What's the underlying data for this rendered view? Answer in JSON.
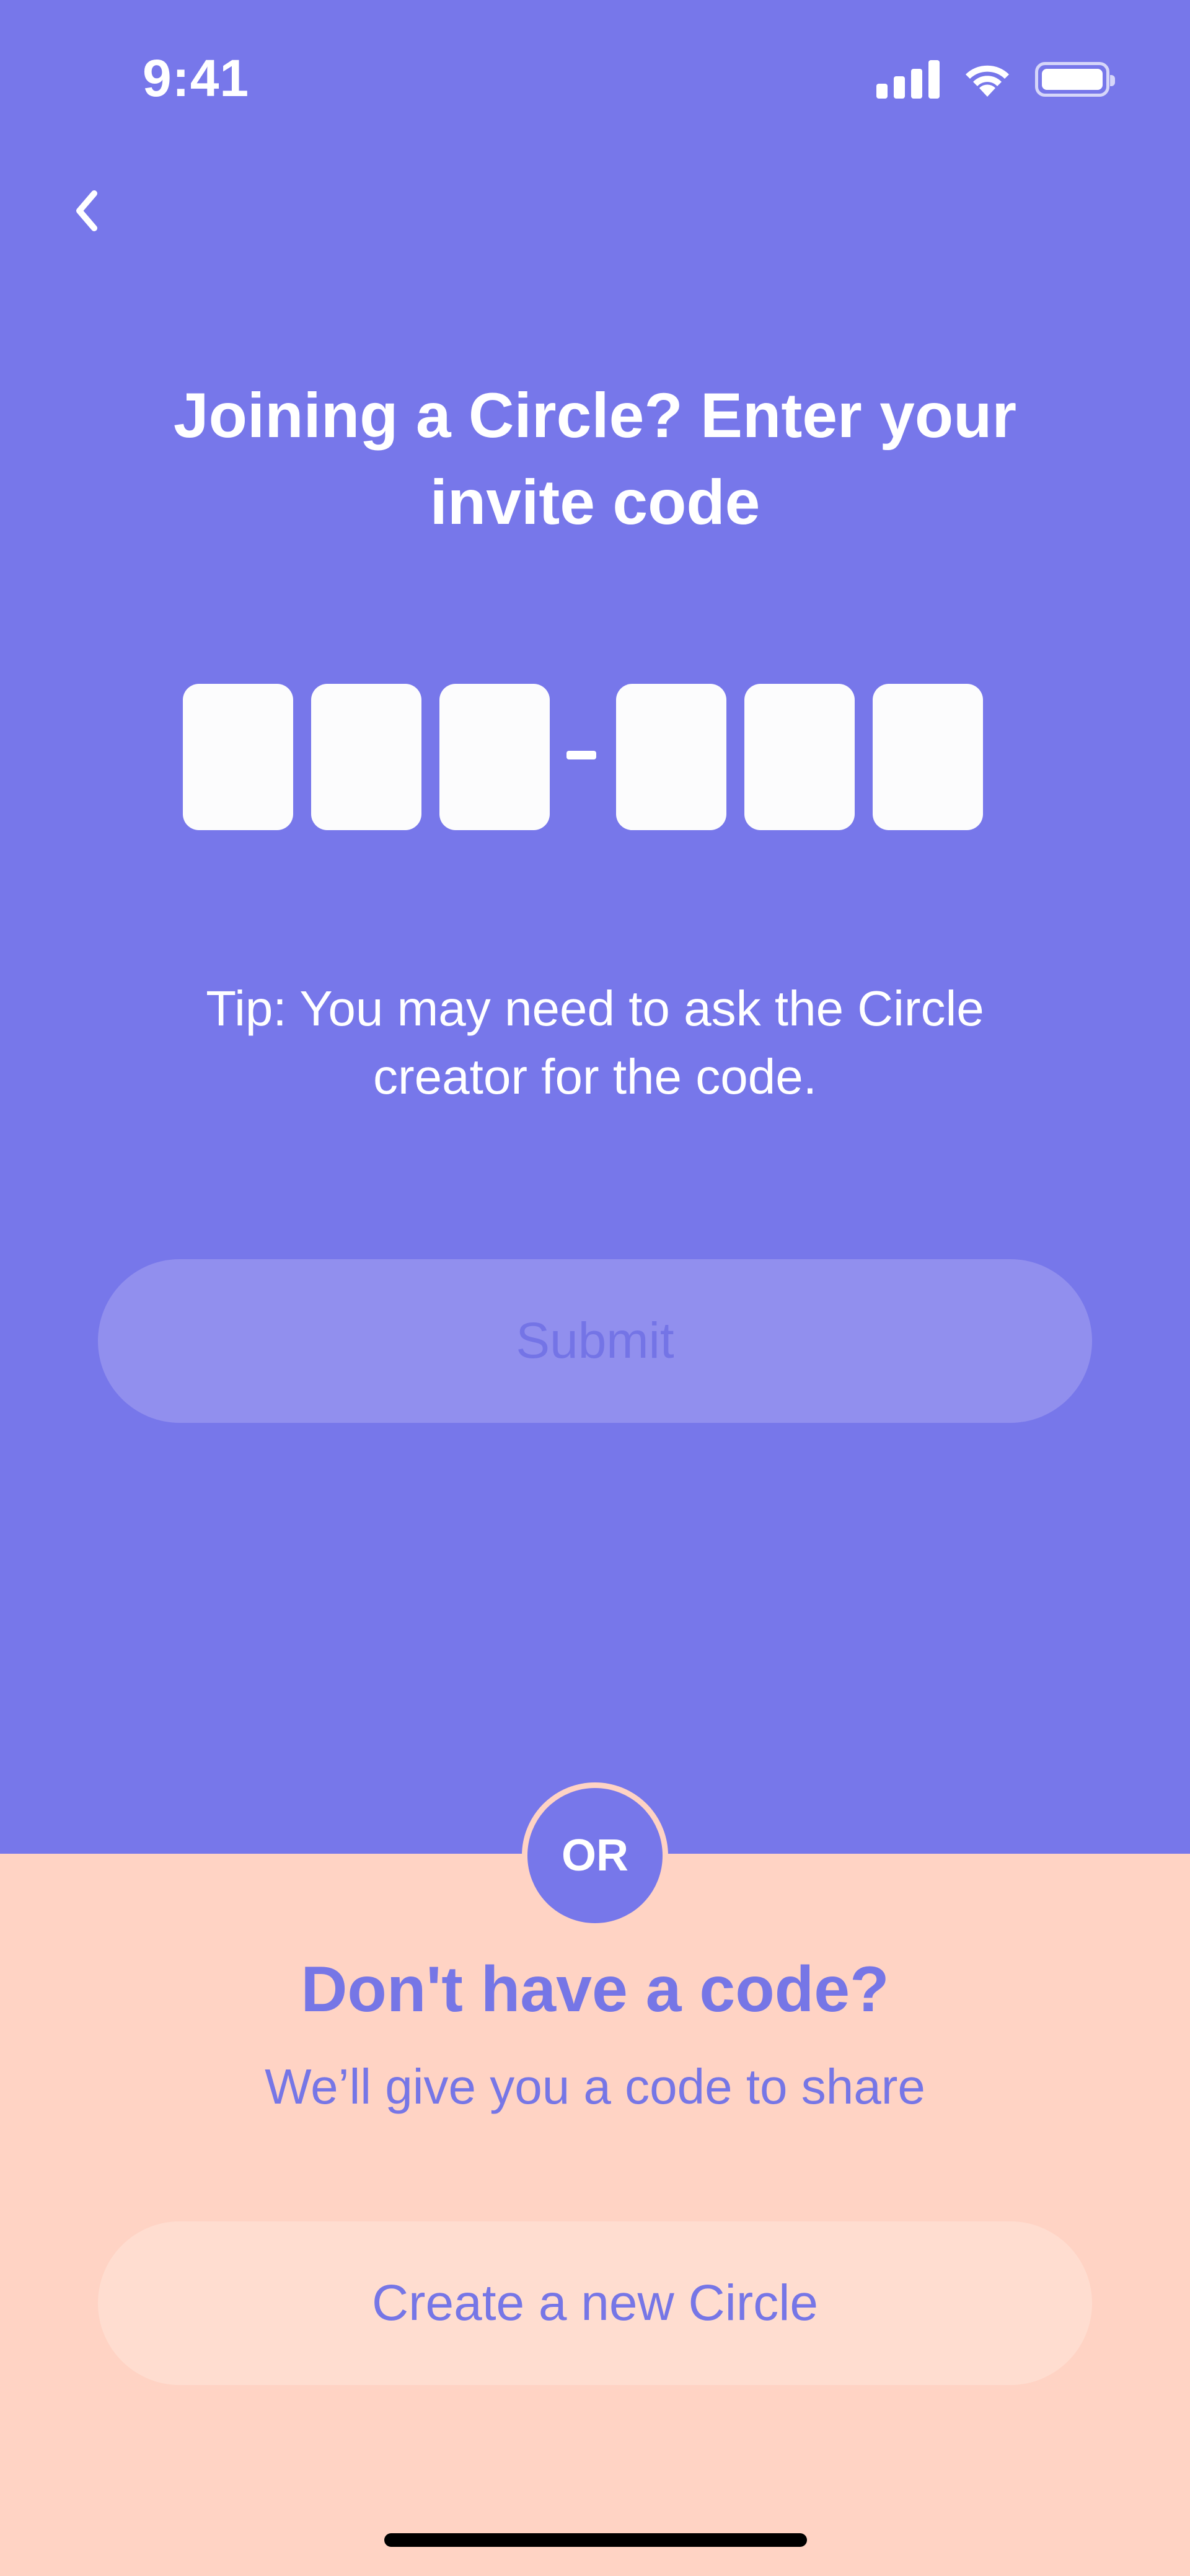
{
  "status_bar": {
    "time": "9:41",
    "icons": [
      "signal-icon",
      "wifi-icon",
      "battery-icon"
    ]
  },
  "nav": {
    "back_icon": "chevron-left-icon"
  },
  "join": {
    "title": "Joining a Circle? Enter your invite code",
    "code_slots": [
      "",
      "",
      "",
      "",
      "",
      ""
    ],
    "separator": "-",
    "tip": "Tip: You may need to ask the Circle creator for the code.",
    "submit_label": "Submit"
  },
  "divider": {
    "label": "OR"
  },
  "create": {
    "heading": "Don't have a code?",
    "subtitle": "We’ll give you a code to share",
    "button_label": "Create a new Circle"
  },
  "colors": {
    "primary": "#7777EA",
    "secondary_bg": "#FFD3C4",
    "button_disabled": "#918FEE",
    "accent_text": "#7676E6"
  }
}
